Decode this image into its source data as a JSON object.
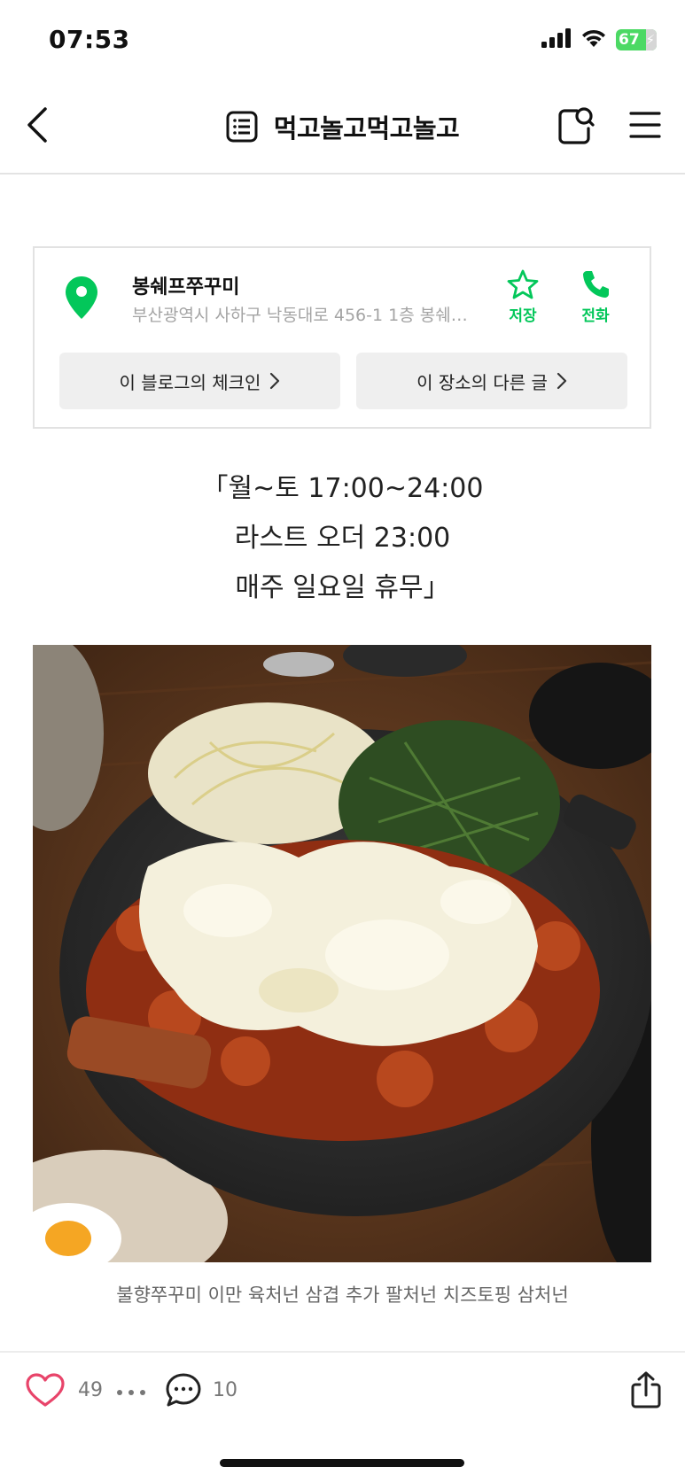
{
  "status_bar": {
    "time": "07:53",
    "battery": "67",
    "signal_icon": "cellular-signal-icon",
    "wifi_icon": "wifi-icon"
  },
  "nav": {
    "title": "먹고놀고먹고놀고",
    "back_icon": "chevron-left-icon",
    "list_icon": "list-icon",
    "search_icon": "blog-search-icon",
    "menu_icon": "hamburger-menu-icon"
  },
  "place": {
    "name": "봉쉐프쭈꾸미",
    "address": "부산광역시 사하구 낙동대로 456-1 1층 봉쉐프쭈꾸미",
    "save_label": "저장",
    "call_label": "전화",
    "checkin_label": "이 블로그의 체크인",
    "other_posts_label": "이 장소의 다른 글",
    "accent": "#03c75a"
  },
  "content": {
    "hours_line1": "「월~토 17:00~24:00",
    "hours_line2": "라스트 오더 23:00",
    "hours_line3": "매주 일요일 휴무」",
    "photo_caption": "불향쭈꾸미 이만 육처넌 삼겹 추가 팔처넌 치즈토핑 삼처넌"
  },
  "bottom": {
    "like_count": "49",
    "comment_count": "10",
    "like_color": "#e8446a"
  }
}
